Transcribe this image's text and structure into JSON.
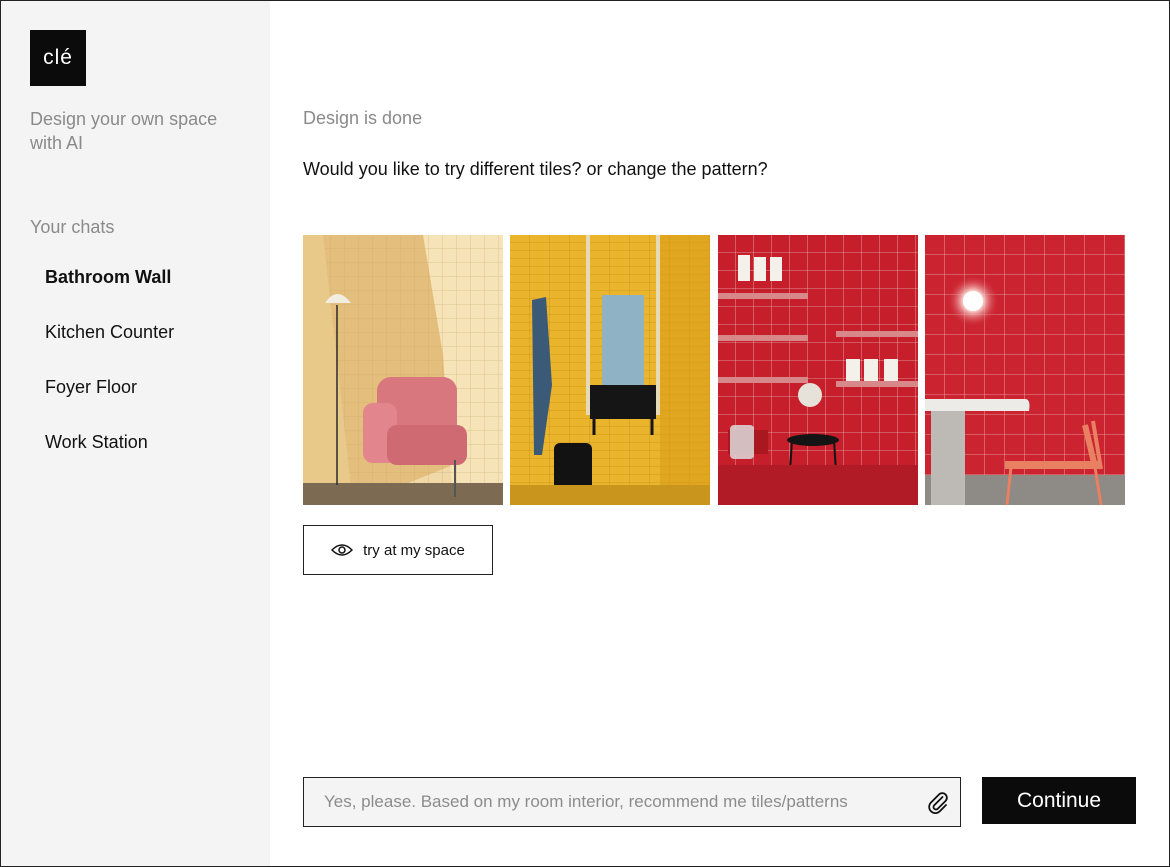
{
  "sidebar": {
    "logo_text": "clé",
    "tagline": "Design your own space with AI",
    "chats_heading": "Your chats",
    "chats": [
      {
        "label": "Bathroom Wall",
        "active": true
      },
      {
        "label": "Kitchen Counter",
        "active": false
      },
      {
        "label": "Foyer Floor",
        "active": false
      },
      {
        "label": "Work Station",
        "active": false
      }
    ]
  },
  "main": {
    "status": "Design is done",
    "question": "Would you like to try different tiles? or change the pattern?",
    "gallery": [
      {
        "scene": "beige-tile-nook-pink-armchair"
      },
      {
        "scene": "yellow-tile-bathroom-black-sink"
      },
      {
        "scene": "red-tile-shelving-stool"
      },
      {
        "scene": "red-tile-wall-table-chair"
      }
    ],
    "try_button": {
      "label": "try at my space",
      "icon": "eye-icon"
    },
    "composer": {
      "placeholder": "Yes, please. Based on my room interior, recommend me tiles/patterns",
      "value": "",
      "attach_icon": "paperclip-icon"
    },
    "continue_label": "Continue"
  },
  "colors": {
    "sidebar_bg": "#f4f4f4",
    "accent": "#0b0b0b",
    "muted_text": "#8a8a8a",
    "tile_yellow": "#e8b52a",
    "tile_red": "#c8202c",
    "tile_beige": "#efd39a"
  }
}
